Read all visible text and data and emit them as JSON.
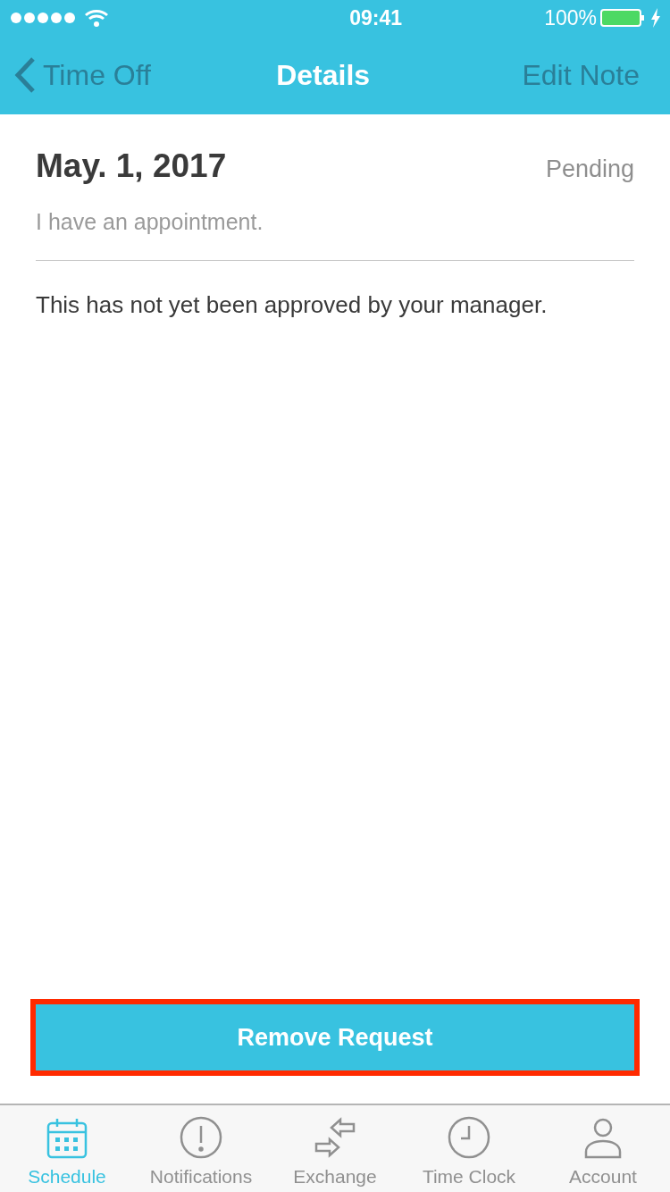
{
  "status_bar": {
    "time": "09:41",
    "battery": "100%"
  },
  "nav": {
    "back": "Time Off",
    "title": "Details",
    "action": "Edit Note"
  },
  "request": {
    "date": "May. 1, 2017",
    "status": "Pending",
    "note": "I have an appointment.",
    "message": "This has not yet been approved by your manager."
  },
  "remove_button": {
    "label": "Remove Request",
    "highlighted": true
  },
  "tabs": [
    {
      "label": "Schedule",
      "kind": "calendar",
      "selected": true
    },
    {
      "label": "Notifications",
      "kind": "alert",
      "selected": false
    },
    {
      "label": "Exchange",
      "kind": "exchange",
      "selected": false
    },
    {
      "label": "Time Clock",
      "kind": "clock",
      "selected": false
    },
    {
      "label": "Account",
      "kind": "person",
      "selected": false
    }
  ]
}
